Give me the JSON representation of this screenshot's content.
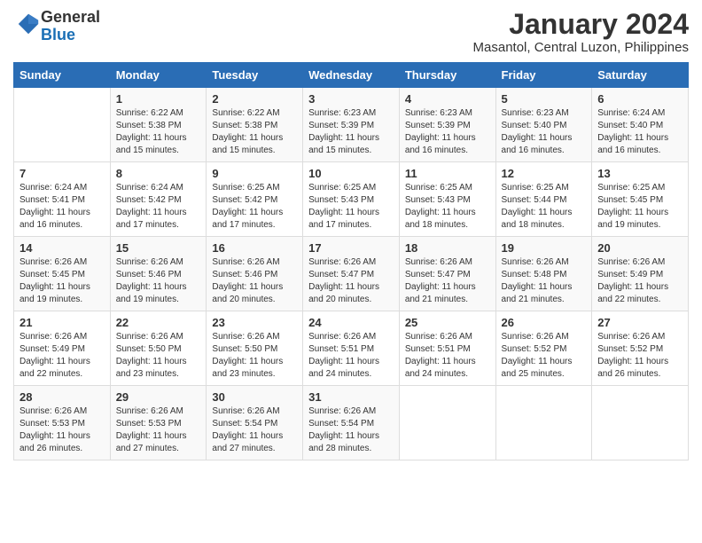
{
  "header": {
    "logo_general": "General",
    "logo_blue": "Blue",
    "month_year": "January 2024",
    "location": "Masantol, Central Luzon, Philippines"
  },
  "days_of_week": [
    "Sunday",
    "Monday",
    "Tuesday",
    "Wednesday",
    "Thursday",
    "Friday",
    "Saturday"
  ],
  "weeks": [
    [
      {
        "day": "",
        "info": ""
      },
      {
        "day": "1",
        "info": "Sunrise: 6:22 AM\nSunset: 5:38 PM\nDaylight: 11 hours\nand 15 minutes."
      },
      {
        "day": "2",
        "info": "Sunrise: 6:22 AM\nSunset: 5:38 PM\nDaylight: 11 hours\nand 15 minutes."
      },
      {
        "day": "3",
        "info": "Sunrise: 6:23 AM\nSunset: 5:39 PM\nDaylight: 11 hours\nand 15 minutes."
      },
      {
        "day": "4",
        "info": "Sunrise: 6:23 AM\nSunset: 5:39 PM\nDaylight: 11 hours\nand 16 minutes."
      },
      {
        "day": "5",
        "info": "Sunrise: 6:23 AM\nSunset: 5:40 PM\nDaylight: 11 hours\nand 16 minutes."
      },
      {
        "day": "6",
        "info": "Sunrise: 6:24 AM\nSunset: 5:40 PM\nDaylight: 11 hours\nand 16 minutes."
      }
    ],
    [
      {
        "day": "7",
        "info": "Sunrise: 6:24 AM\nSunset: 5:41 PM\nDaylight: 11 hours\nand 16 minutes."
      },
      {
        "day": "8",
        "info": "Sunrise: 6:24 AM\nSunset: 5:42 PM\nDaylight: 11 hours\nand 17 minutes."
      },
      {
        "day": "9",
        "info": "Sunrise: 6:25 AM\nSunset: 5:42 PM\nDaylight: 11 hours\nand 17 minutes."
      },
      {
        "day": "10",
        "info": "Sunrise: 6:25 AM\nSunset: 5:43 PM\nDaylight: 11 hours\nand 17 minutes."
      },
      {
        "day": "11",
        "info": "Sunrise: 6:25 AM\nSunset: 5:43 PM\nDaylight: 11 hours\nand 18 minutes."
      },
      {
        "day": "12",
        "info": "Sunrise: 6:25 AM\nSunset: 5:44 PM\nDaylight: 11 hours\nand 18 minutes."
      },
      {
        "day": "13",
        "info": "Sunrise: 6:25 AM\nSunset: 5:45 PM\nDaylight: 11 hours\nand 19 minutes."
      }
    ],
    [
      {
        "day": "14",
        "info": "Sunrise: 6:26 AM\nSunset: 5:45 PM\nDaylight: 11 hours\nand 19 minutes."
      },
      {
        "day": "15",
        "info": "Sunrise: 6:26 AM\nSunset: 5:46 PM\nDaylight: 11 hours\nand 19 minutes."
      },
      {
        "day": "16",
        "info": "Sunrise: 6:26 AM\nSunset: 5:46 PM\nDaylight: 11 hours\nand 20 minutes."
      },
      {
        "day": "17",
        "info": "Sunrise: 6:26 AM\nSunset: 5:47 PM\nDaylight: 11 hours\nand 20 minutes."
      },
      {
        "day": "18",
        "info": "Sunrise: 6:26 AM\nSunset: 5:47 PM\nDaylight: 11 hours\nand 21 minutes."
      },
      {
        "day": "19",
        "info": "Sunrise: 6:26 AM\nSunset: 5:48 PM\nDaylight: 11 hours\nand 21 minutes."
      },
      {
        "day": "20",
        "info": "Sunrise: 6:26 AM\nSunset: 5:49 PM\nDaylight: 11 hours\nand 22 minutes."
      }
    ],
    [
      {
        "day": "21",
        "info": "Sunrise: 6:26 AM\nSunset: 5:49 PM\nDaylight: 11 hours\nand 22 minutes."
      },
      {
        "day": "22",
        "info": "Sunrise: 6:26 AM\nSunset: 5:50 PM\nDaylight: 11 hours\nand 23 minutes."
      },
      {
        "day": "23",
        "info": "Sunrise: 6:26 AM\nSunset: 5:50 PM\nDaylight: 11 hours\nand 23 minutes."
      },
      {
        "day": "24",
        "info": "Sunrise: 6:26 AM\nSunset: 5:51 PM\nDaylight: 11 hours\nand 24 minutes."
      },
      {
        "day": "25",
        "info": "Sunrise: 6:26 AM\nSunset: 5:51 PM\nDaylight: 11 hours\nand 24 minutes."
      },
      {
        "day": "26",
        "info": "Sunrise: 6:26 AM\nSunset: 5:52 PM\nDaylight: 11 hours\nand 25 minutes."
      },
      {
        "day": "27",
        "info": "Sunrise: 6:26 AM\nSunset: 5:52 PM\nDaylight: 11 hours\nand 26 minutes."
      }
    ],
    [
      {
        "day": "28",
        "info": "Sunrise: 6:26 AM\nSunset: 5:53 PM\nDaylight: 11 hours\nand 26 minutes."
      },
      {
        "day": "29",
        "info": "Sunrise: 6:26 AM\nSunset: 5:53 PM\nDaylight: 11 hours\nand 27 minutes."
      },
      {
        "day": "30",
        "info": "Sunrise: 6:26 AM\nSunset: 5:54 PM\nDaylight: 11 hours\nand 27 minutes."
      },
      {
        "day": "31",
        "info": "Sunrise: 6:26 AM\nSunset: 5:54 PM\nDaylight: 11 hours\nand 28 minutes."
      },
      {
        "day": "",
        "info": ""
      },
      {
        "day": "",
        "info": ""
      },
      {
        "day": "",
        "info": ""
      }
    ]
  ]
}
